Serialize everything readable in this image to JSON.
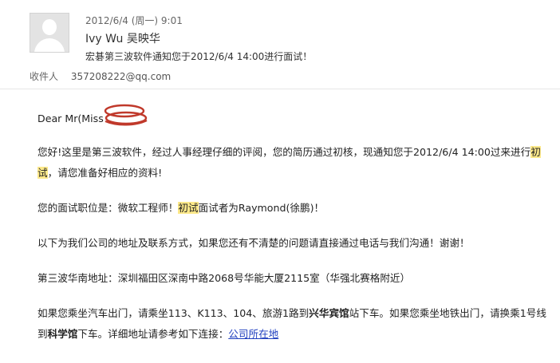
{
  "header": {
    "date": "2012/6/4 (周一) 9:01",
    "sender": "Ivy Wu 吴映华",
    "subject": "宏碁第三波软件通知您于2012/6/4 14:00进行面试！"
  },
  "recipient": {
    "label": "收件人",
    "address": "357208222@qq.com"
  },
  "body": {
    "greeting": "Dear Mr(Miss",
    "p1_line1_text": "您好!这里是第三波软件，经过人事经理仔细的评阅，您的简历通过初核，现通知您于2012/6/4  14:00过来进行",
    "p1_line1_hl": "初",
    "p1_line2_hl": "试",
    "p1_line2_text": "，请您准备好相应的资料!",
    "p2_before": "您的面试职位是：微软工程师！",
    "p2_hl": "初试",
    "p2_after": "面试者为Raymond(徐鹏)！",
    "p3": "以下为我们公司的地址及联系方式，如果您还有不清楚的问题请直接通过电话与我们沟通！谢谢！",
    "p4": "第三波华南地址：深圳福田区深南中路2068号华能大厦2115室（华强北赛格附近）",
    "p5_line1_a": "如果您乘坐汽车出门，请乘坐113、K113、104、旅游1路到",
    "p5_line1_bold": "兴华宾馆",
    "p5_line1_b": "站下车。如果您乘坐地铁出门，请换乘1号线",
    "p5_line2_a": "到",
    "p5_line2_bold": "科学馆",
    "p5_line2_b": "下车。详细地址请参考如下连接：",
    "p5_link": "公司所在地"
  },
  "colors": {
    "highlight": "#fde98a",
    "scribble": "#c0392b",
    "link": "#1f3fbf"
  }
}
